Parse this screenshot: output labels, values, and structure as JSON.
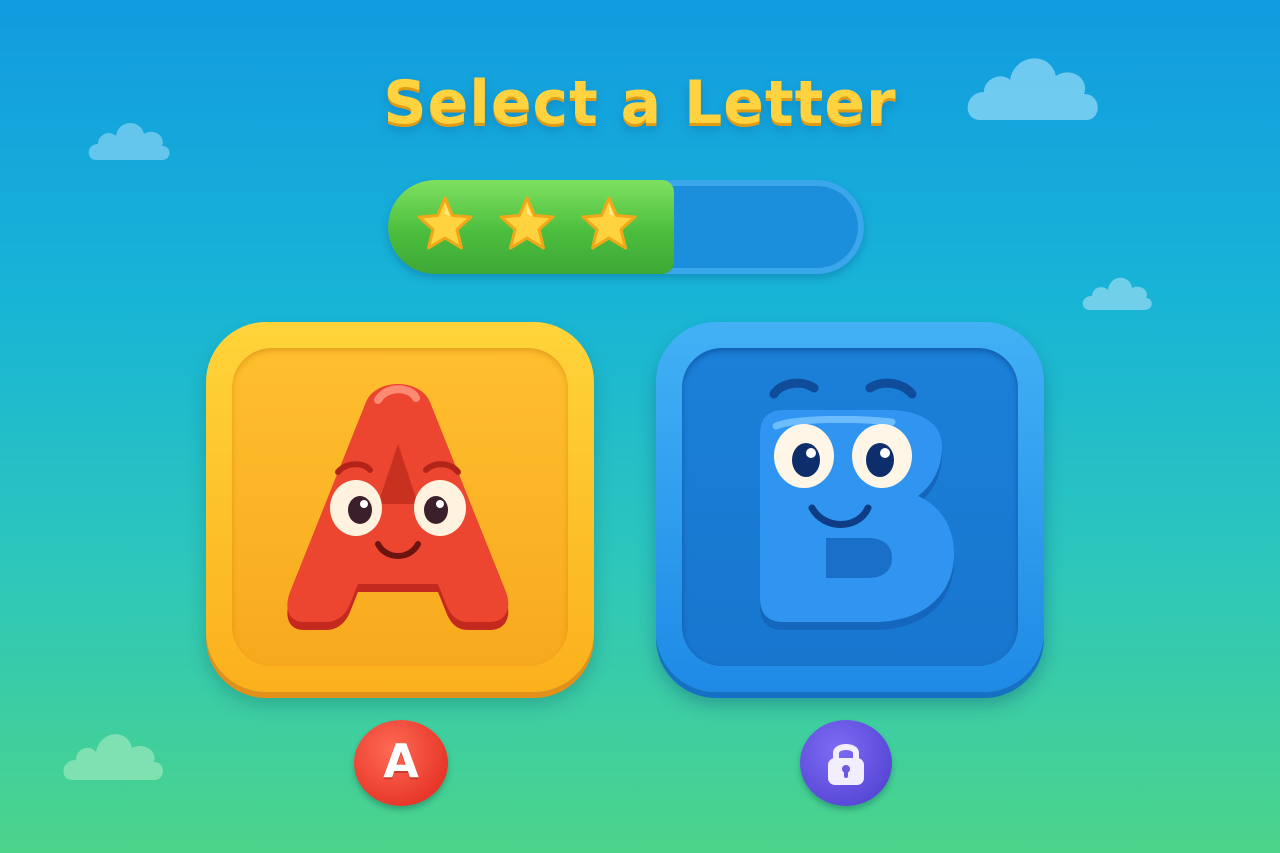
{
  "screen": {
    "title": "Select a Letter"
  },
  "progress": {
    "value_fraction": 0.6,
    "stars_earned": 3,
    "star_icon": "star-icon",
    "colors": {
      "fill": "#4cbe3e",
      "track": "#1b8fdc",
      "star": "#ffd23f"
    }
  },
  "letters": [
    {
      "letter": "A",
      "state": "unlocked",
      "card_color": "#fbb01c",
      "character_color": "#e8392b",
      "badge_label": "A",
      "badge_color": "#e8392b"
    },
    {
      "letter": "B",
      "state": "locked",
      "card_color": "#1e8ae6",
      "character_color": "#2f95f0",
      "badge_icon": "lock-icon",
      "badge_color": "#5a4ad8"
    }
  ],
  "colors": {
    "sky_top": "#129be0",
    "sky_bottom": "#4cd48a",
    "title": "#ffd23f"
  }
}
